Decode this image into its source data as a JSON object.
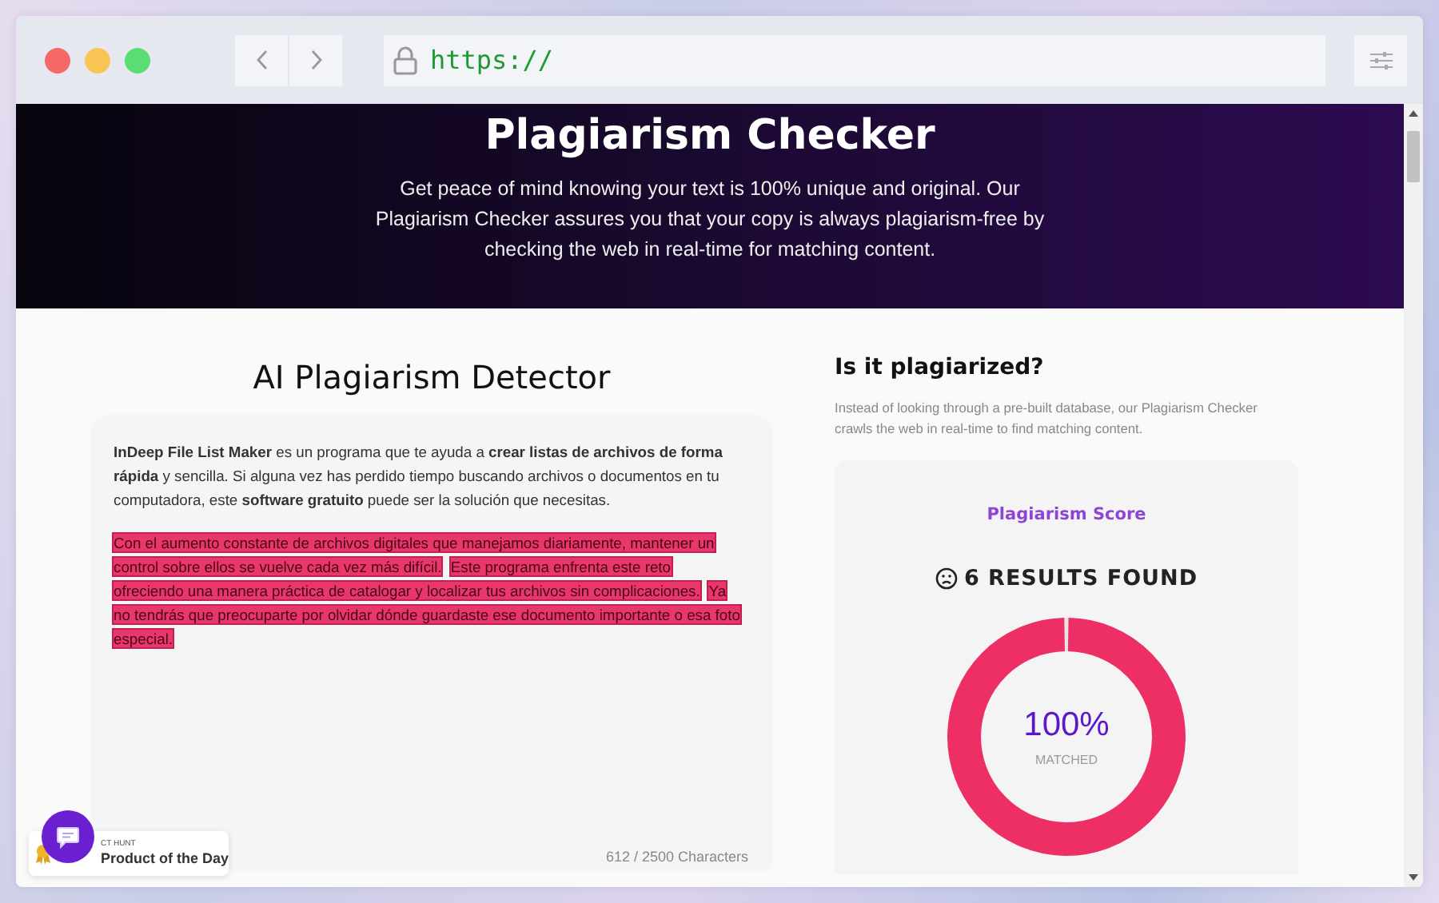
{
  "browser": {
    "url": "https://"
  },
  "hero": {
    "title": "Plagiarism Checker",
    "description": "Get peace of mind knowing your text is 100% unique and original. Our Plagiarism Checker assures you that your copy is always plagiarism-free by checking the web in real-time for matching content."
  },
  "detector": {
    "title": "AI Plagiarism Detector",
    "paragraphs": [
      {
        "segments": [
          {
            "text": "**InDeep File List Maker** es un programa que te ayuda a **crear listas de archivos de forma rápida** y sencilla. Si alguna vez has perdido tiempo buscando archivos o documentos en tu computadora, este **software gratuito** puede ser la solución que necesitas.",
            "highlighted": false
          }
        ]
      },
      {
        "lines": [
          {
            "segments": [
              {
                "text": "Con el aumento constante de archivos digitales que manejamos diariamente, mantener un",
                "highlighted": true
              }
            ]
          },
          {
            "segments": [
              {
                "text": "control sobre ellos se vuelve cada vez más difícil.",
                "highlighted": true
              },
              {
                "text": "Este programa enfrenta este reto",
                "highlighted": true
              }
            ]
          },
          {
            "segments": [
              {
                "text": "ofreciendo una manera práctica de catalogar y localizar tus archivos sin complicaciones.",
                "highlighted": true
              },
              {
                "text": "Ya",
                "highlighted": true
              }
            ]
          },
          {
            "segments": [
              {
                "text": "no tendrás que preocuparte por olvidar dónde guardaste ese documento importante o esa foto",
                "highlighted": true
              }
            ]
          },
          {
            "segments": [
              {
                "text": "especial.",
                "highlighted": true
              }
            ]
          }
        ]
      }
    ],
    "counter": "612 / 2500 Characters"
  },
  "result": {
    "heading": "Is it plagiarized?",
    "description": "Instead of looking through a pre-built database, our Plagiarism Checker crawls the web in real-time to find matching content.",
    "score_label": "Plagiarism Score",
    "results": "6 RESULTS FOUND",
    "meter": {
      "level": 1,
      "reading": "100%",
      "caption": "MATCHED"
    }
  },
  "badge": {
    "overline": "CT HUNT",
    "title": "Product of the Day"
  }
}
